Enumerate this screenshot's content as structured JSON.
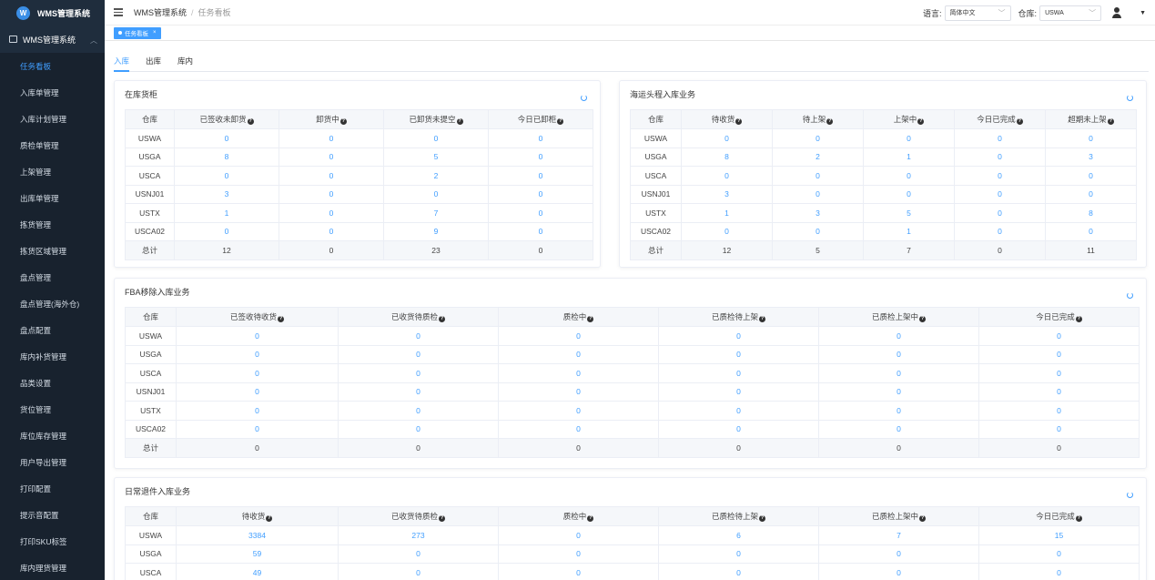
{
  "app": {
    "logo_letter": "W",
    "title": "WMS管理系统"
  },
  "sidebar": {
    "parent": "WMS管理系统",
    "items": [
      "任务看板",
      "入库单管理",
      "入库计划管理",
      "质检单管理",
      "上架管理",
      "出库单管理",
      "拣货管理",
      "拣货区域管理",
      "盘点管理",
      "盘点管理(海外仓)",
      "盘点配置",
      "库内补货管理",
      "品类设置",
      "货位管理",
      "库位库存管理",
      "用户导出管理",
      "打印配置",
      "提示音配置",
      "打印SKU标签",
      "库内理货管理"
    ],
    "active_index": 0
  },
  "header": {
    "breadcrumb_root": "WMS管理系统",
    "breadcrumb_sep": "/",
    "breadcrumb_current": "任务看板",
    "lang_label": "语言:",
    "lang_value": "简体中文",
    "wh_label": "仓库:",
    "wh_value": "USWA"
  },
  "tags": [
    {
      "label": "任务看板"
    }
  ],
  "tabs": [
    "入库",
    "出库",
    "库内"
  ],
  "cards": [
    {
      "title": "在库货柜",
      "headers": [
        "仓库",
        "已签收未卸货",
        "卸货中",
        "已卸货未提空",
        "今日已卸柜"
      ],
      "help": [
        false,
        true,
        true,
        true,
        true
      ],
      "rows": [
        [
          "USWA",
          "0",
          "0",
          "0",
          "0"
        ],
        [
          "USGA",
          "8",
          "0",
          "5",
          "0"
        ],
        [
          "USCA",
          "0",
          "0",
          "2",
          "0"
        ],
        [
          "USNJ01",
          "3",
          "0",
          "0",
          "0"
        ],
        [
          "USTX",
          "1",
          "0",
          "7",
          "0"
        ],
        [
          "USCA02",
          "0",
          "0",
          "9",
          "0"
        ]
      ],
      "total": [
        "总计",
        "12",
        "0",
        "23",
        "0"
      ]
    },
    {
      "title": "海运头程入库业务",
      "headers": [
        "仓库",
        "待收货",
        "待上架",
        "上架中",
        "今日已完成",
        "超期未上架"
      ],
      "help": [
        false,
        true,
        true,
        true,
        true,
        true
      ],
      "rows": [
        [
          "USWA",
          "0",
          "0",
          "0",
          "0",
          "0"
        ],
        [
          "USGA",
          "8",
          "2",
          "1",
          "0",
          "3"
        ],
        [
          "USCA",
          "0",
          "0",
          "0",
          "0",
          "0"
        ],
        [
          "USNJ01",
          "3",
          "0",
          "0",
          "0",
          "0"
        ],
        [
          "USTX",
          "1",
          "3",
          "5",
          "0",
          "8"
        ],
        [
          "USCA02",
          "0",
          "0",
          "1",
          "0",
          "0"
        ]
      ],
      "total": [
        "总计",
        "12",
        "5",
        "7",
        "0",
        "11"
      ]
    },
    {
      "title": "FBA移除入库业务",
      "headers": [
        "仓库",
        "已签收待收货",
        "已收货待质检",
        "质检中",
        "已质检待上架",
        "已质检上架中",
        "今日已完成"
      ],
      "help": [
        false,
        true,
        true,
        true,
        true,
        true,
        true
      ],
      "rows": [
        [
          "USWA",
          "0",
          "0",
          "0",
          "0",
          "0",
          "0"
        ],
        [
          "USGA",
          "0",
          "0",
          "0",
          "0",
          "0",
          "0"
        ],
        [
          "USCA",
          "0",
          "0",
          "0",
          "0",
          "0",
          "0"
        ],
        [
          "USNJ01",
          "0",
          "0",
          "0",
          "0",
          "0",
          "0"
        ],
        [
          "USTX",
          "0",
          "0",
          "0",
          "0",
          "0",
          "0"
        ],
        [
          "USCA02",
          "0",
          "0",
          "0",
          "0",
          "0",
          "0"
        ]
      ],
      "total": [
        "总计",
        "0",
        "0",
        "0",
        "0",
        "0",
        "0"
      ]
    },
    {
      "title": "日常退件入库业务",
      "headers": [
        "仓库",
        "待收货",
        "已收货待质检",
        "质检中",
        "已质检待上架",
        "已质检上架中",
        "今日已完成"
      ],
      "help": [
        false,
        true,
        true,
        true,
        true,
        true,
        true
      ],
      "rows": [
        [
          "USWA",
          "3384",
          "273",
          "0",
          "6",
          "7",
          "15"
        ],
        [
          "USGA",
          "59",
          "0",
          "0",
          "0",
          "0",
          "0"
        ],
        [
          "USCA",
          "49",
          "0",
          "0",
          "0",
          "0",
          "0"
        ]
      ],
      "total": null
    }
  ],
  "colors": {
    "accent": "#409eff",
    "sidebar_bg": "#1f2d3d",
    "sidebar_sub_bg": "#18222e"
  }
}
